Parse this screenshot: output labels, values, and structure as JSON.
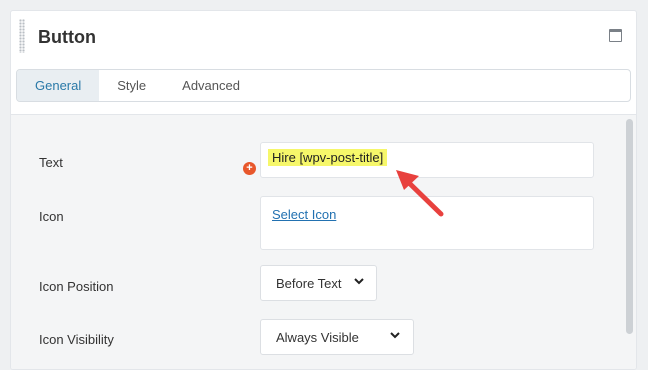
{
  "panel": {
    "title": "Button"
  },
  "tabs": [
    {
      "label": "General",
      "active": true
    },
    {
      "label": "Style",
      "active": false
    },
    {
      "label": "Advanced",
      "active": false
    }
  ],
  "fields": {
    "text": {
      "label": "Text",
      "value": "Hire [wpv-post-title]"
    },
    "icon": {
      "label": "Icon",
      "link": "Select Icon"
    },
    "icon_position": {
      "label": "Icon Position",
      "value": "Before Text"
    },
    "icon_visibility": {
      "label": "Icon Visibility",
      "value": "Always Visible"
    }
  },
  "icons": {
    "drag": "drag-handle-icon",
    "window": "window-icon",
    "add": "plus-icon",
    "chevron": "chevron-down-icon",
    "annotation": "arrow-annotation"
  },
  "colors": {
    "accent": "#2a79a8",
    "highlight": "#f6f76a",
    "arrow": "#e8413e",
    "add_dot": "#e8572b",
    "link": "#2271b1"
  }
}
